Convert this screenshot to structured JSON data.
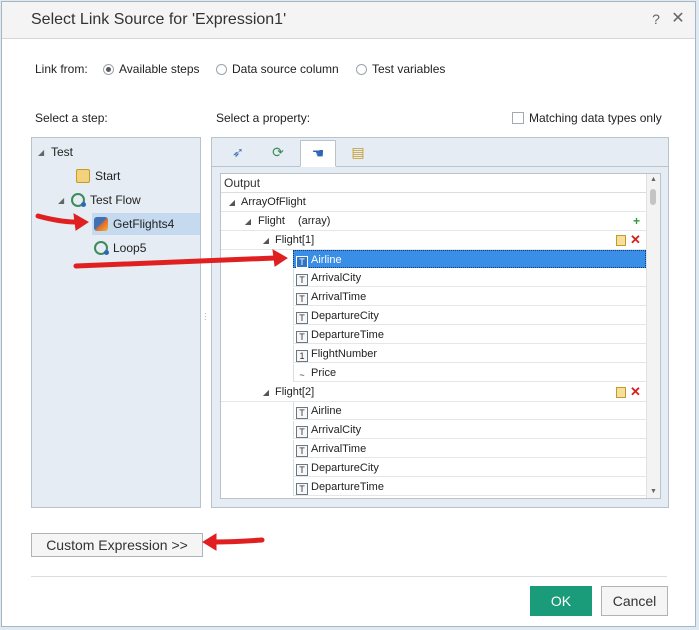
{
  "dialog": {
    "title": "Select Link Source for 'Expression1'",
    "help": "?",
    "close": "✕"
  },
  "link_from": {
    "label": "Link from:",
    "options": [
      "Available steps",
      "Data source column",
      "Test variables"
    ],
    "selected": "Available steps"
  },
  "steps": {
    "label": "Select a step:",
    "items": [
      "Test",
      "Start",
      "Test Flow",
      "GetFlights4",
      "Loop5"
    ],
    "selected": "GetFlights4"
  },
  "properties": {
    "label": "Select a property:",
    "matching_label": "Matching data types only",
    "tab_icons": [
      "rocket-icon",
      "refresh-icon",
      "hand-icon",
      "document-icon"
    ],
    "header": "Output",
    "root": "ArrayOfFlight",
    "flight_label": "Flight",
    "flight_type": "(array)",
    "groups": [
      {
        "label": "Flight[1]",
        "fields": [
          {
            "name": "Airline",
            "type": "T"
          },
          {
            "name": "ArrivalCity",
            "type": "T"
          },
          {
            "name": "ArrivalTime",
            "type": "T"
          },
          {
            "name": "DepartureCity",
            "type": "T"
          },
          {
            "name": "DepartureTime",
            "type": "T"
          },
          {
            "name": "FlightNumber",
            "type": "1"
          },
          {
            "name": "Price",
            "type": "~"
          }
        ]
      },
      {
        "label": "Flight[2]",
        "fields": [
          {
            "name": "Airline",
            "type": "T"
          },
          {
            "name": "ArrivalCity",
            "type": "T"
          },
          {
            "name": "ArrivalTime",
            "type": "T"
          },
          {
            "name": "DepartureCity",
            "type": "T"
          },
          {
            "name": "DepartureTime",
            "type": "T"
          }
        ]
      }
    ],
    "selected_field": "Airline"
  },
  "buttons": {
    "custom_expression": "Custom Expression >>",
    "ok": "OK",
    "cancel": "Cancel"
  },
  "colors": {
    "ok_button": "#1a9b7a",
    "selection": "#3a8ee6",
    "annotation_arrow": "#e02020"
  }
}
